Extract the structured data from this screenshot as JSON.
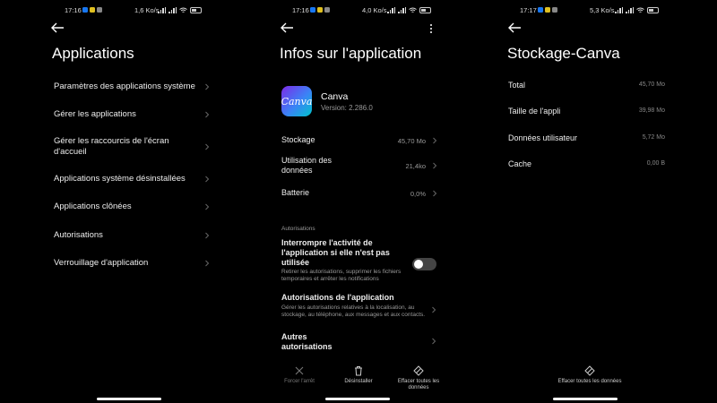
{
  "screens": [
    {
      "status": {
        "time": "17:16",
        "speed": "1,6 Ko/s",
        "battery": "▭"
      },
      "title": "Applications",
      "items": [
        "Paramètres des applications système",
        "Gérer les applications",
        "Gérer les raccourcis de l'écran d'accueil",
        "Applications système désinstallées",
        "Applications clônées",
        "Autorisations",
        "Verrouillage d'application"
      ]
    },
    {
      "status": {
        "time": "17:16",
        "speed": "4,0 Ko/s"
      },
      "title": "Infos sur l'application",
      "app": {
        "name": "Canva",
        "version": "Version: 2.286.0",
        "icon_text": "Canva"
      },
      "rows": [
        {
          "label": "Stockage",
          "value": "45,70 Mo"
        },
        {
          "label": "Utilisation des données",
          "value": "21,4ko"
        },
        {
          "label": "Batterie",
          "value": "0,0%"
        }
      ],
      "section": "Autorisations",
      "permissions": [
        {
          "title": "Interrompre l'activité de l'application si elle n'est pas utilisée",
          "desc": "Retirer les autorisations, supprimer les fichiers temporaires et arrêter les notifications"
        },
        {
          "title": "Autorisations de l'application",
          "desc": "Gérer les autorisations relatives à la localisation, au stockage, au téléphone, aux messages et aux contacts."
        },
        {
          "title": "Autres autorisations",
          "desc": ""
        }
      ],
      "bottom": [
        {
          "label": "Forcer l'arrêt",
          "icon": "close-icon"
        },
        {
          "label": "Désinstaller",
          "icon": "trash-icon"
        },
        {
          "label": "Effacer toutes les données",
          "icon": "eraser-icon"
        }
      ]
    },
    {
      "status": {
        "time": "17:17",
        "speed": "5,3 Ko/s"
      },
      "title": "Stockage-Canva",
      "rows": [
        {
          "label": "Total",
          "value": "45,70 Mo"
        },
        {
          "label": "Taille de l'appli",
          "value": "39,98 Mo"
        },
        {
          "label": "Données utilisateur",
          "value": "5,72 Mo"
        },
        {
          "label": "Cache",
          "value": "0,00 B"
        }
      ],
      "bottom": [
        {
          "label": "Effacer toutes les données",
          "icon": "eraser-icon"
        }
      ]
    }
  ]
}
